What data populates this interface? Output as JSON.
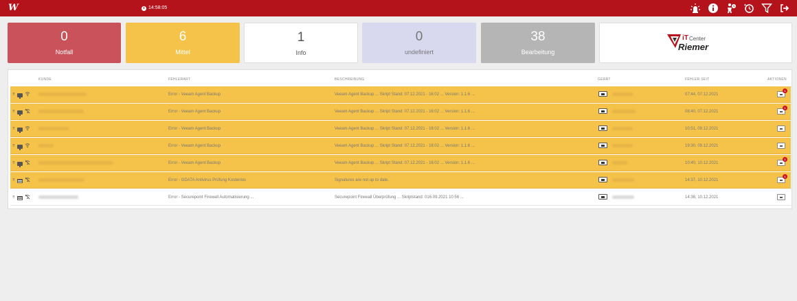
{
  "header": {
    "logo_letter": "W",
    "time": "14:58:05",
    "icons": [
      "alarm-light-icon",
      "info-icon",
      "user-clock-icon",
      "history-icon",
      "filter-icon",
      "logout-icon"
    ]
  },
  "tiles": [
    {
      "count": "0",
      "label": "Notfall",
      "color": "#c9525b"
    },
    {
      "count": "6",
      "label": "Mittel",
      "color": "#f5c34a"
    },
    {
      "count": "1",
      "label": "Info",
      "color": "#ffffff"
    },
    {
      "count": "0",
      "label": "undefiniert",
      "color": "#d8d9ef"
    },
    {
      "count": "38",
      "label": "Bearbeitung",
      "color": "#b5b5b5"
    }
  ],
  "brand": {
    "line1_it": "iT",
    "line1_center": "Center",
    "line2": "Riemer"
  },
  "table": {
    "columns": [
      "KUNDE",
      "FEHLERART",
      "BESCHREIBUNG",
      "GERÄT",
      "FEHLER SEIT",
      "AKTIONEN"
    ],
    "rows": [
      {
        "status": "warn",
        "type": "wifi",
        "error": "Error - Veeam Agent Backup",
        "desc": "Veeam Agent Backup ... Skript Stand: 07.12.2021 - 16:02 ... Version: 1.1.6 ...",
        "since": "07:44, 07.12.2021",
        "badge": "1"
      },
      {
        "status": "warn",
        "type": "wifi-off",
        "error": "Error - Veeam Agent Backup",
        "desc": "Veeam Agent Backup ... Skript Stand: 07.12.2021 - 16:02 ... Version: 1.1.6 ...",
        "since": "08:40, 07.12.2021",
        "badge": "1"
      },
      {
        "status": "warn",
        "type": "wifi",
        "error": "Error - Veeam Agent Backup",
        "desc": "Veeam Agent Backup ... Skript Stand: 07.12.2021 - 16:02 ... Version: 1.1.6 ...",
        "since": "10:51, 09.12.2021",
        "badge": ""
      },
      {
        "status": "warn",
        "type": "wifi",
        "error": "Error - Veeam Agent Backup",
        "desc": "Veeam Agent Backup ... Skript Stand: 07.12.2021 - 16:02 ... Version: 1.1.6 ...",
        "since": "19:30, 09.12.2021",
        "badge": ""
      },
      {
        "status": "warn",
        "type": "wifi-off",
        "error": "Error - Veeam Agent Backup",
        "desc": "Veeam Agent Backup ... Skript Stand: 07.12.2021 - 16:02 ... Version: 1.1.6 ...",
        "since": "10:40, 10.12.2021",
        "badge": "1"
      },
      {
        "status": "warn",
        "type": "server",
        "error": "Error - GDATA Antivirus Prüfung Kostenlos",
        "desc": "Signatures are not up to date.",
        "since": "14:37, 10.12.2021",
        "badge": "1"
      },
      {
        "status": "plain",
        "type": "server",
        "error": "Error - Securepoint Firewall Automatisierung ...",
        "desc": "Securepoint Firewall Überprüfung ... Skriptstand: 016.09.2021 10:56 ...",
        "since": "14:36, 10.12.2021",
        "badge": ""
      }
    ]
  }
}
